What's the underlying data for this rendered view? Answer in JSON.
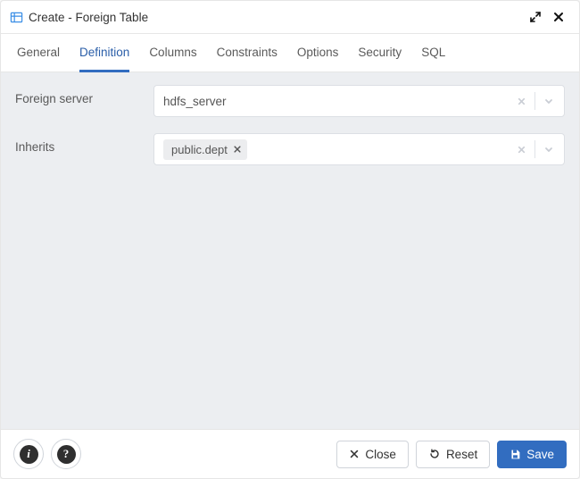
{
  "dialog_title": "Create - Foreign Table",
  "tabs": {
    "general": "General",
    "definition": "Definition",
    "columns": "Columns",
    "constraints": "Constraints",
    "options": "Options",
    "security": "Security",
    "sql": "SQL"
  },
  "active_tab": "definition",
  "form": {
    "foreign_server": {
      "label": "Foreign server",
      "value": "hdfs_server"
    },
    "inherits": {
      "label": "Inherits",
      "tokens": [
        "public.dept"
      ]
    }
  },
  "footer": {
    "info_glyph": "i",
    "help_glyph": "?",
    "close": "Close",
    "reset": "Reset",
    "save": "Save"
  }
}
